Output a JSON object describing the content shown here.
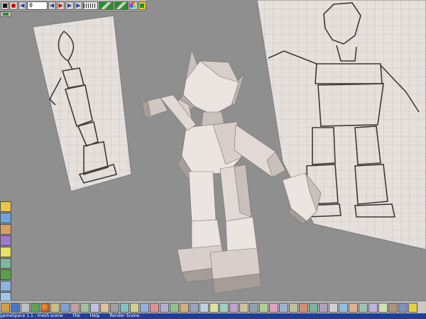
{
  "toolbar": {
    "frame_value": "0",
    "buttons": [
      "stop",
      "record",
      "rewind",
      "step-back",
      "play",
      "step-forward",
      "fast-forward",
      "timeline",
      "track-1",
      "track-2",
      "color-wheel",
      "render-settings"
    ]
  },
  "status": {
    "app_title": "gameSpace 1.1 - mesh.scene",
    "menu_file": "File",
    "menu_help": "Help",
    "mode": "Render Scene"
  },
  "colors": {
    "viewport_bg": "#8f8f8f",
    "paper": "#e6e0dc",
    "grid_line": "#b6aca6",
    "model_light": "#ece4e0",
    "model_mid": "#c9bfbb",
    "model_dark": "#8e8682",
    "status_bar": "#1f3e9c"
  },
  "palette_icons": [
    "layer-icon",
    "object-icon",
    "material-icon",
    "texture-icon",
    "light-icon",
    "camera-icon",
    "terrain-icon",
    "scene-icon",
    "sky-icon",
    "effects-icon"
  ],
  "bottom_icons": [
    "start-icon",
    "browser-icon",
    "pen-icon",
    "paint-icon",
    "sphere-icon",
    "brush-icon",
    "tools-icon"
  ]
}
